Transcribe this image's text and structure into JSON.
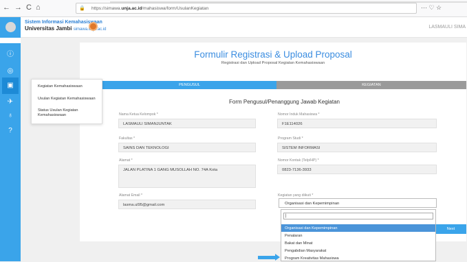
{
  "browser": {
    "nav": [
      "←",
      "→",
      "C",
      "⌂"
    ],
    "url_prefix": "https://simawa.",
    "url_domain": "unja.ac.id",
    "url_path": "/mahasiswa/form/UsulanKegiatan",
    "right_icons": "··· ♡ ☆"
  },
  "header": {
    "line1": "Sistem Informasi Kemahasiswaan",
    "line2": "Universitas Jambi",
    "line2_domain": "simawa.unja.ac.id",
    "username": "LASMAULI SIMA"
  },
  "sidebar": {
    "icons": [
      "ⓘ",
      "◎",
      "▣",
      "✈",
      "♁",
      "?"
    ],
    "flyout": [
      "Kegiatan Kemahasiswaan",
      "Usulan Kegiatan Kemahasiswaan",
      "Status Usulan Kegiatan Kemahasiswaan"
    ]
  },
  "form": {
    "title": "Formulir Registrasi & Upload Proposal",
    "subtitle": "Registrasi dan Upload Proposal Kegiatan Kemahasiswaan",
    "tab1": "PENGUSUL",
    "tab2": "KEGIATAN",
    "heading": "Form Pengusul/Penanggung Jawab Kegiatan",
    "fields": {
      "nama_label": "Nama Ketua Kelompok *",
      "nama_value": "LASMAULI SIMANJUNTAK",
      "nim_label": "Nomor Induk Mahasiswa *",
      "nim_value": "F1E114026",
      "fakultas_label": "Fakultas *",
      "fakultas_value": "SAINS DAN TEKNOLOGI",
      "prodi_label": "Program Studi *",
      "prodi_value": "SISTEM INFORMASI",
      "alamat_label": "Alamat *",
      "alamat_value": "JALAN PLATINA 1 GANG MUSOLLAH NO. 74A   Kota",
      "kontak_label": "Nomor Kontak (Telp/HP) *",
      "kontak_value": "0823-7136-3933",
      "email_label": "Alamat Email *",
      "email_value": "lasma.ul95@gmail.com",
      "kegiatan_label": "Kegiatan yang diikuti *"
    },
    "next_button": "Next"
  },
  "dropdown": {
    "selected": "Organisasi dan Kepemimpinan",
    "search_value": "|",
    "options": [
      "Organisasi dan Kepemimpinan",
      "Penalaran",
      "Bakat dan Minat",
      "Pengabdian Masyarakat",
      "Program Kreativitas Mahasiswa"
    ],
    "highlighted_index": 0
  },
  "colors": {
    "accent": "#3aa4ea",
    "tab_inactive": "#9a9a9a",
    "title": "#3b8de0"
  }
}
